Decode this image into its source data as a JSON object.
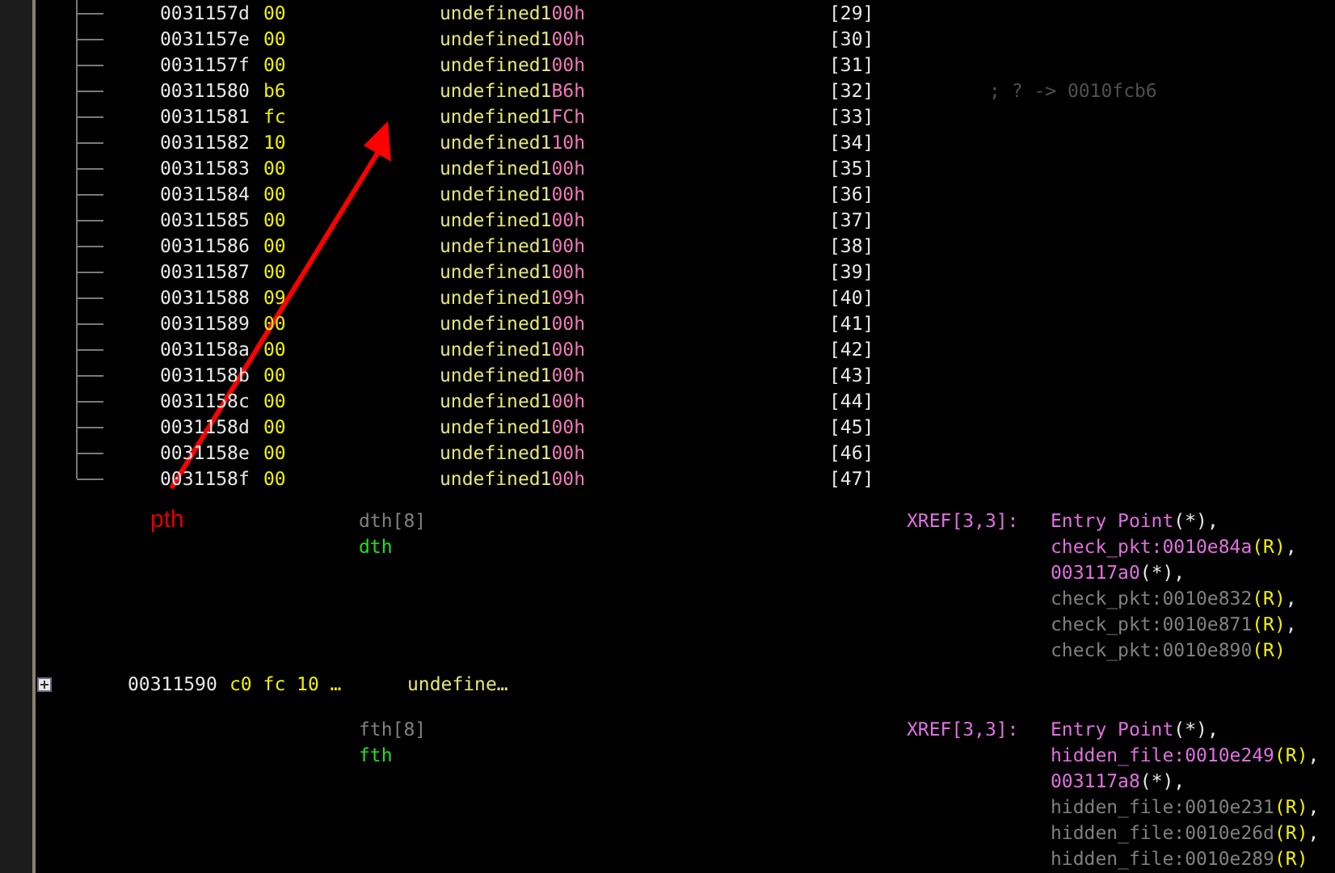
{
  "rows": [
    {
      "address": "0031157d",
      "byte": "00",
      "type": "undefined1",
      "value": "00h",
      "index": "[29]"
    },
    {
      "address": "0031157e",
      "byte": "00",
      "type": "undefined1",
      "value": "00h",
      "index": "[30]"
    },
    {
      "address": "0031157f",
      "byte": "00",
      "type": "undefined1",
      "value": "00h",
      "index": "[31]"
    },
    {
      "address": "00311580",
      "byte": "b6",
      "type": "undefined1",
      "value": "B6h",
      "index": "[32]",
      "comment": "; ?  ->  0010fcb6"
    },
    {
      "address": "00311581",
      "byte": "fc",
      "type": "undefined1",
      "value": "FCh",
      "index": "[33]"
    },
    {
      "address": "00311582",
      "byte": "10",
      "type": "undefined1",
      "value": "10h",
      "index": "[34]"
    },
    {
      "address": "00311583",
      "byte": "00",
      "type": "undefined1",
      "value": "00h",
      "index": "[35]"
    },
    {
      "address": "00311584",
      "byte": "00",
      "type": "undefined1",
      "value": "00h",
      "index": "[36]"
    },
    {
      "address": "00311585",
      "byte": "00",
      "type": "undefined1",
      "value": "00h",
      "index": "[37]"
    },
    {
      "address": "00311586",
      "byte": "00",
      "type": "undefined1",
      "value": "00h",
      "index": "[38]"
    },
    {
      "address": "00311587",
      "byte": "00",
      "type": "undefined1",
      "value": "00h",
      "index": "[39]"
    },
    {
      "address": "00311588",
      "byte": "09",
      "type": "undefined1",
      "value": "09h",
      "index": "[40]"
    },
    {
      "address": "00311589",
      "byte": "00",
      "type": "undefined1",
      "value": "00h",
      "index": "[41]"
    },
    {
      "address": "0031158a",
      "byte": "00",
      "type": "undefined1",
      "value": "00h",
      "index": "[42]"
    },
    {
      "address": "0031158b",
      "byte": "00",
      "type": "undefined1",
      "value": "00h",
      "index": "[43]"
    },
    {
      "address": "0031158c",
      "byte": "00",
      "type": "undefined1",
      "value": "00h",
      "index": "[44]"
    },
    {
      "address": "0031158d",
      "byte": "00",
      "type": "undefined1",
      "value": "00h",
      "index": "[45]"
    },
    {
      "address": "0031158e",
      "byte": "00",
      "type": "undefined1",
      "value": "00h",
      "index": "[46]"
    },
    {
      "address": "0031158f",
      "byte": "00",
      "type": "undefined1",
      "value": "00h",
      "index": "[47]"
    }
  ],
  "annotation": {
    "label": "pth"
  },
  "items": [
    {
      "kind": "label",
      "name_field": "dth[8]",
      "label": "dth",
      "xref_label": "XREF[3,3]:",
      "xrefs": [
        {
          "ref": "Entry Point",
          "pointer_tag": "(*)",
          "sep": ",",
          "kind": "primary"
        },
        {
          "ref": "check_pkt:0010e84a",
          "read_tag": "(R)",
          "sep": ",",
          "kind": "primary"
        },
        {
          "ref": "003117a0",
          "pointer_tag": "(*)",
          "sep": ",",
          "kind": "primary"
        },
        {
          "ref": "check_pkt:0010e832",
          "read_tag": "(R)",
          "sep": ",",
          "kind": "secondary"
        },
        {
          "ref": "check_pkt:0010e871",
          "read_tag": "(R)",
          "sep": ",",
          "kind": "secondary"
        },
        {
          "ref": "check_pkt:0010e890",
          "read_tag": "(R)",
          "kind": "secondary"
        }
      ]
    },
    {
      "kind": "collapsed",
      "expanded": false,
      "address": "00311590",
      "bytes": "c0 fc 10 …",
      "type": "undefine…"
    },
    {
      "kind": "label",
      "name_field": "fth[8]",
      "label": "fth",
      "xref_label": "XREF[3,3]:",
      "xrefs": [
        {
          "ref": "Entry Point",
          "pointer_tag": "(*)",
          "sep": ",",
          "kind": "primary"
        },
        {
          "ref": "hidden_file:0010e249",
          "read_tag": "(R)",
          "sep": ",",
          "kind": "primary"
        },
        {
          "ref": "003117a8",
          "pointer_tag": "(*)",
          "sep": ",",
          "kind": "primary"
        },
        {
          "ref": "hidden_file:0010e231",
          "read_tag": "(R)",
          "sep": ",",
          "kind": "secondary"
        },
        {
          "ref": "hidden_file:0010e26d",
          "read_tag": "(R)",
          "sep": ",",
          "kind": "secondary"
        },
        {
          "ref": "hidden_file:0010e289",
          "read_tag": "(R)",
          "kind": "secondary"
        }
      ]
    }
  ]
}
